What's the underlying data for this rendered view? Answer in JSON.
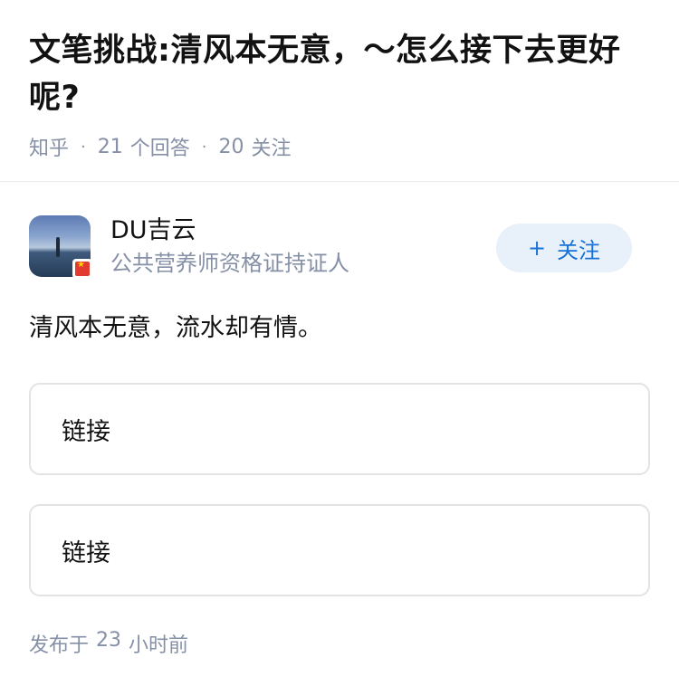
{
  "question": {
    "title": "文笔挑战:清风本无意，～怎么接下去更好呢?",
    "source": "知乎",
    "separator": "·",
    "answer_count": "21",
    "answer_label": "个回答",
    "follower_count": "20",
    "follower_label": "关注"
  },
  "answer": {
    "author_name": "DU吉云",
    "author_headline": "公共营养师资格证持证人",
    "follow_plus": "+",
    "follow_label": "关注",
    "text": "清风本无意，流水却有情。",
    "links": [
      "链接",
      "链接"
    ],
    "publish_prefix": "发布于",
    "publish_number": "23",
    "publish_suffix": "小时前"
  }
}
